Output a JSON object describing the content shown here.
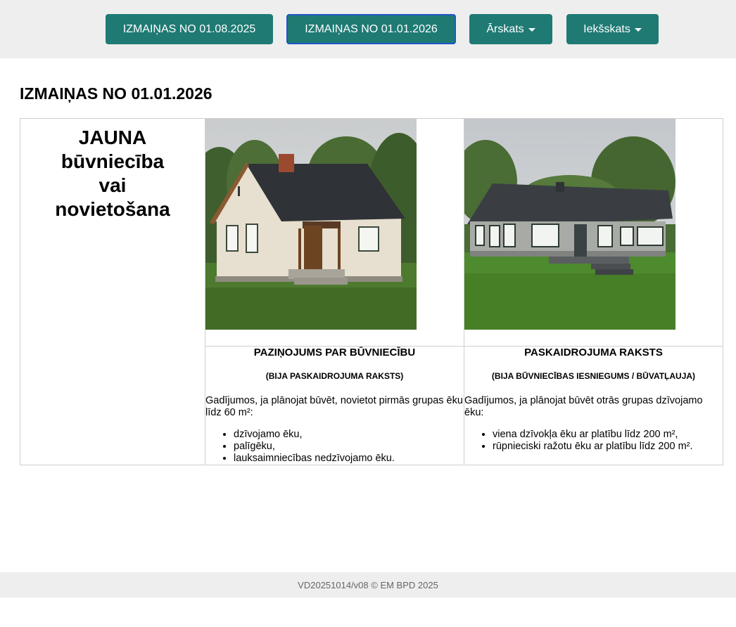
{
  "nav": {
    "btn1": "IZMAIŅAS NO 01.08.2025",
    "btn2": "IZMAIŅAS NO 01.01.2026",
    "btn3": "Ārskats",
    "btn4": "Iekšskats"
  },
  "page_title": "IZMAIŅAS NO 01.01.2026",
  "left_heading": {
    "line1": "JAUNA",
    "line2": "būvniecība",
    "line3": "vai",
    "line4": "novietošana"
  },
  "cards": [
    {
      "title": "PAZIŅOJUMS PAR BŪVNIECĪBU",
      "subtitle": "(BIJA PASKAIDROJUMA RAKSTS)",
      "description": "Gadījumos, ja plānojat būvēt, novietot pirmās grupas ēku līdz 60 m²:",
      "items": [
        "dzīvojamo ēku,",
        "palīgēku,",
        "lauksaimniecības nedzīvojamo ēku."
      ]
    },
    {
      "title": "PASKAIDROJUMA RAKSTS",
      "subtitle": "(BIJA BŪVNIECĪBAS IESNIEGUMS / BŪVATĻAUJA)",
      "description": "Gadījumos, ja plānojat būvēt otrās grupas dzīvojamo ēku:",
      "items": [
        "viena dzīvokļa ēku ar platību līdz 200 m²,",
        "rūpnieciski ražotu ēku ar platību līdz 200 m²."
      ]
    }
  ],
  "footer": "VD20251014/v08 © EM BPD 2025",
  "colors": {
    "accent": "#1f7a74",
    "active_border": "#1f55c8",
    "bar": "#eeeeee"
  }
}
